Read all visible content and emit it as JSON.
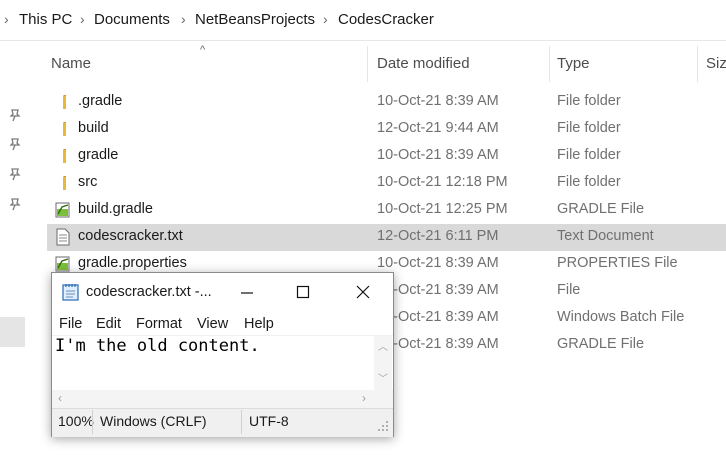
{
  "breadcrumb": [
    "This PC",
    "Documents",
    "NetBeansProjects",
    "CodesCracker"
  ],
  "columns": {
    "name": "Name",
    "date": "Date modified",
    "type": "Type",
    "size": "Siz"
  },
  "files": [
    {
      "name": ".gradle",
      "date": "10-Oct-21 8:39 AM",
      "type": "File folder",
      "icon": "folder-icon"
    },
    {
      "name": "build",
      "date": "12-Oct-21 9:44 AM",
      "type": "File folder",
      "icon": "folder-icon"
    },
    {
      "name": "gradle",
      "date": "10-Oct-21 8:39 AM",
      "type": "File folder",
      "icon": "folder-icon"
    },
    {
      "name": "src",
      "date": "10-Oct-21 12:18 PM",
      "type": "File folder",
      "icon": "folder-icon"
    },
    {
      "name": "build.gradle",
      "date": "10-Oct-21 12:25 PM",
      "type": "GRADLE File",
      "icon": "gradle-file-icon"
    },
    {
      "name": "codescracker.txt",
      "date": "12-Oct-21 6:11 PM",
      "type": "Text Document",
      "icon": "text-file-icon"
    },
    {
      "name": "gradle.properties",
      "date": "10-Oct-21 8:39 AM",
      "type": "PROPERTIES File",
      "icon": "properties-file-icon"
    },
    {
      "name": "",
      "date": "10-Oct-21 8:39 AM",
      "type": "File",
      "icon": ""
    },
    {
      "name": "",
      "date": "10-Oct-21 8:39 AM",
      "type": "Windows Batch File",
      "icon": ""
    },
    {
      "name": "",
      "date": "10-Oct-21 8:39 AM",
      "type": "GRADLE File",
      "icon": ""
    }
  ],
  "notepad": {
    "title": "codescracker.txt -...",
    "menu": [
      "File",
      "Edit",
      "Format",
      "View",
      "Help"
    ],
    "content": "I'm the old content.",
    "status": {
      "zoom": "100%",
      "line_ending": "Windows (CRLF)",
      "encoding": "UTF-8"
    }
  },
  "colors": {
    "selected_row": "#d9d9d9",
    "folder": "#e8b938",
    "secondary_text": "#707070"
  }
}
